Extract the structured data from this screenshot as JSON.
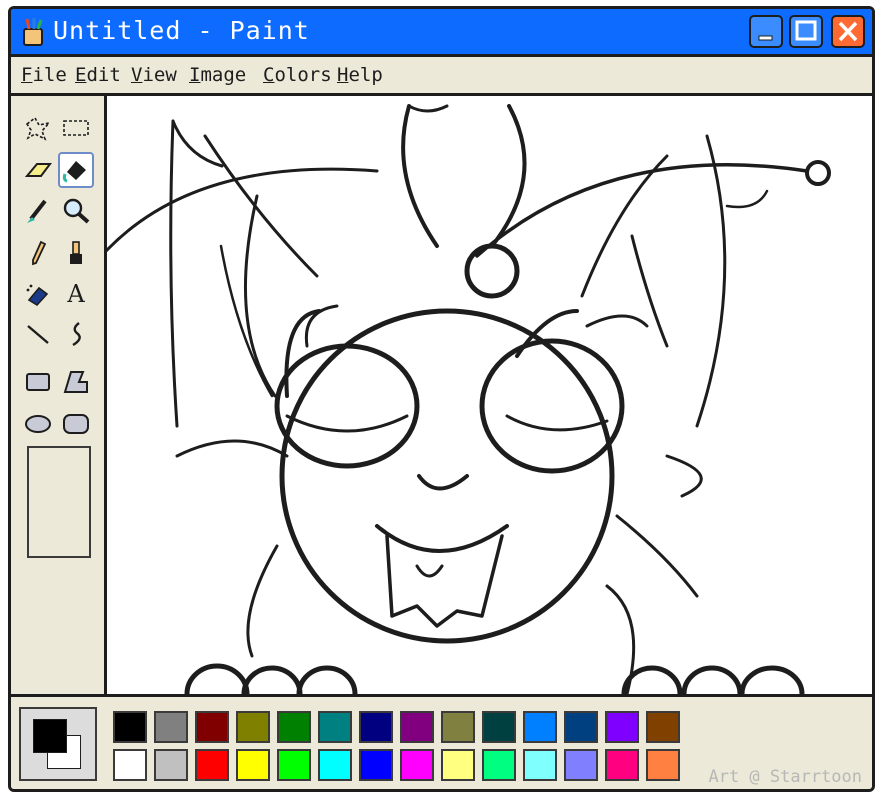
{
  "window": {
    "title": "Untitled - Paint",
    "app_icon": "paint-brushes-icon",
    "minimize_icon": "minimize-icon",
    "maximize_icon": "maximize-icon",
    "close_icon": "close-icon",
    "title_color": "#0e6bff",
    "close_color": "#ff6a33"
  },
  "menu": {
    "file": "File",
    "edit": "Edit",
    "view": "View",
    "image": "Image",
    "colors": "Colors",
    "help": "Help"
  },
  "tools": [
    {
      "name": "free-form-select-icon"
    },
    {
      "name": "rectangle-select-icon"
    },
    {
      "name": "eraser-icon"
    },
    {
      "name": "fill-bucket-icon",
      "selected": true
    },
    {
      "name": "color-picker-icon"
    },
    {
      "name": "magnifier-icon"
    },
    {
      "name": "pencil-icon"
    },
    {
      "name": "brush-icon"
    },
    {
      "name": "airbrush-icon"
    },
    {
      "name": "text-icon",
      "glyph": "A"
    },
    {
      "name": "line-icon"
    },
    {
      "name": "curve-icon"
    },
    {
      "name": "rectangle-icon"
    },
    {
      "name": "polygon-icon"
    },
    {
      "name": "ellipse-icon"
    },
    {
      "name": "rounded-rectangle-icon"
    }
  ],
  "current_colors": {
    "foreground": "#000000",
    "background": "#ffffff"
  },
  "palette": {
    "row1": [
      "#000000",
      "#808080",
      "#800000",
      "#808000",
      "#008000",
      "#008080",
      "#000080",
      "#800080",
      "#808040",
      "#004040",
      "#0080ff",
      "#004080",
      "#8000ff",
      "#804000"
    ],
    "row2": [
      "#ffffff",
      "#c0c0c0",
      "#ff0000",
      "#ffff00",
      "#00ff00",
      "#00ffff",
      "#0000ff",
      "#ff00ff",
      "#ffff80",
      "#00ff80",
      "#80ffff",
      "#8080ff",
      "#ff0080",
      "#ff8040"
    ]
  },
  "credit": "Art @ Starrtoon"
}
